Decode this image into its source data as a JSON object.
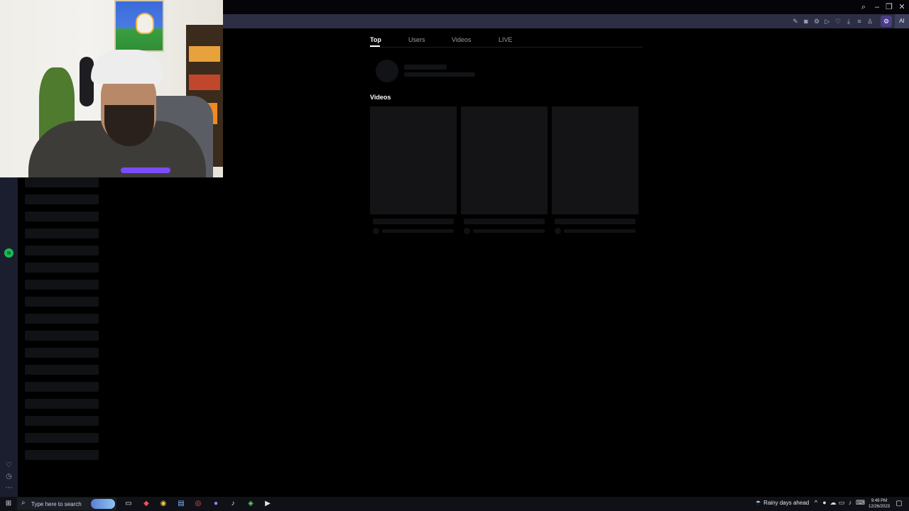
{
  "search_tabs": [
    "Top",
    "Users",
    "Videos",
    "LIVE"
  ],
  "active_tab": "Top",
  "sections": {
    "videos_title": "Videos"
  },
  "video_placeholders": 3,
  "sidebar_skeleton_rows": 17,
  "taskbar": {
    "search_placeholder": "Type here to search",
    "weather": "Rainy days ahead",
    "time": "9:49 PM",
    "date": "12/26/2023"
  },
  "window_controls": [
    "search-icon",
    "minimize-icon",
    "restore-icon",
    "close-icon"
  ],
  "toolbar_icons": [
    "edit-icon",
    "camera-icon",
    "settings-icon",
    "play-icon",
    "heart-icon",
    "download-icon",
    "menu-icon",
    "user-icon",
    "extension-icon",
    "ai-icon"
  ],
  "toolbar_ai_label": "AI",
  "rail_icons": [
    "spotify-icon",
    "heart-icon",
    "clock-icon",
    "more-icon"
  ],
  "colors": {
    "accent_spotify": "#1db954",
    "toolbar_bg": "#2c2f43",
    "rail_bg": "#1b1e2e"
  }
}
